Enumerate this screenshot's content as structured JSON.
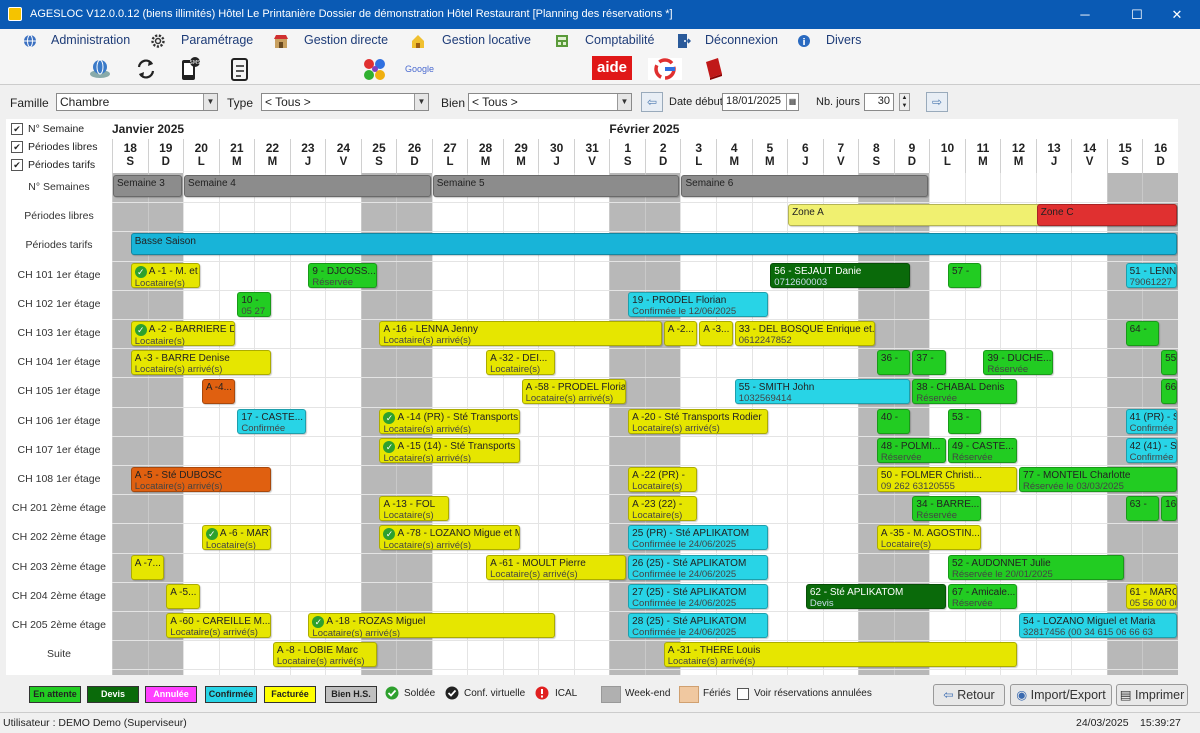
{
  "window": {
    "title": "AGESLOC V12.0.0.12 (biens illimités)   Hôtel Le Printanière   Dossier de démonstration Hôtel Restaurant   [Planning des réservations *]",
    "minimize": "─",
    "maximize": "☐",
    "close": "✕"
  },
  "menu": [
    {
      "label": "Administration",
      "icon": "globe-icon"
    },
    {
      "label": "Paramétrage",
      "icon": "gear-icon"
    },
    {
      "label": "Gestion directe",
      "icon": "shop-icon"
    },
    {
      "label": "Gestion locative",
      "icon": "house-icon"
    },
    {
      "label": "Comptabilité",
      "icon": "ledger-icon"
    },
    {
      "label": "Déconnexion",
      "icon": "door-icon"
    },
    {
      "label": "Divers",
      "icon": "info-icon"
    }
  ],
  "toolbar": {
    "google_label": "Google",
    "aide_label": "aide"
  },
  "filters": {
    "famille_label": "Famille",
    "famille_value": "Chambre",
    "type_label": "Type",
    "type_value": "< Tous >",
    "bien_label": "Bien",
    "bien_value": "< Tous >",
    "date_label": "Date début",
    "date_value": "18/01/2025",
    "nb_label": "Nb. jours",
    "nb_value": "30"
  },
  "checks": [
    {
      "label": "N° Semaine",
      "checked": true
    },
    {
      "label": "Périodes libres",
      "checked": true
    },
    {
      "label": "Périodes tarifs",
      "checked": true
    }
  ],
  "months": [
    {
      "label": "Janvier 2025",
      "day": 0
    },
    {
      "label": "Février 2025",
      "day": 14
    }
  ],
  "days": [
    {
      "n": "18",
      "l": "S",
      "we": true
    },
    {
      "n": "19",
      "l": "D",
      "we": true
    },
    {
      "n": "20",
      "l": "L"
    },
    {
      "n": "21",
      "l": "M"
    },
    {
      "n": "22",
      "l": "M"
    },
    {
      "n": "23",
      "l": "J"
    },
    {
      "n": "24",
      "l": "V"
    },
    {
      "n": "25",
      "l": "S",
      "we": true
    },
    {
      "n": "26",
      "l": "D",
      "we": true
    },
    {
      "n": "27",
      "l": "L"
    },
    {
      "n": "28",
      "l": "M"
    },
    {
      "n": "29",
      "l": "M"
    },
    {
      "n": "30",
      "l": "J"
    },
    {
      "n": "31",
      "l": "V"
    },
    {
      "n": "1",
      "l": "S",
      "we": true
    },
    {
      "n": "2",
      "l": "D",
      "we": true
    },
    {
      "n": "3",
      "l": "L"
    },
    {
      "n": "4",
      "l": "M"
    },
    {
      "n": "5",
      "l": "M"
    },
    {
      "n": "6",
      "l": "J"
    },
    {
      "n": "7",
      "l": "V"
    },
    {
      "n": "8",
      "l": "S",
      "we": true
    },
    {
      "n": "9",
      "l": "D",
      "we": true
    },
    {
      "n": "10",
      "l": "L"
    },
    {
      "n": "11",
      "l": "M"
    },
    {
      "n": "12",
      "l": "M"
    },
    {
      "n": "13",
      "l": "J"
    },
    {
      "n": "14",
      "l": "V"
    },
    {
      "n": "15",
      "l": "S",
      "we": true
    },
    {
      "n": "16",
      "l": "D",
      "we": true
    }
  ],
  "rows": [
    "N° Semaines",
    "Périodes libres",
    "Périodes tarifs",
    "CH 101 1er étage",
    "CH 102 1er étage",
    "CH 103 1er étage",
    "CH 104 1er étage",
    "CH 105 1er étage",
    "CH 106 1er étage",
    "CH 107 1er étage",
    "CH 108 1er étage",
    "CH 201 2ème étage",
    "CH 202 2ème étage",
    "CH 203 2ème étage",
    "CH 204 2ème étage",
    "CH 205 2ème étage",
    "Suite"
  ],
  "colors": {
    "grey": "#8c8c8c",
    "yellow": "#e6e600",
    "cyan": "#28d4e6",
    "green": "#22cc22",
    "dgreen": "#0a6a0a",
    "orange": "#e06010",
    "ltyellow": "#f0f070",
    "red": "#e03030",
    "blue": "#18b4d8"
  },
  "bars": [
    {
      "row": 0,
      "start": 0,
      "len": 2,
      "color": "grey",
      "t1": "Semaine 3",
      "t2": ""
    },
    {
      "row": 0,
      "start": 2,
      "len": 7,
      "color": "grey",
      "t1": "Semaine 4",
      "t2": ""
    },
    {
      "row": 0,
      "start": 9,
      "len": 7,
      "color": "grey",
      "t1": "Semaine 5",
      "t2": ""
    },
    {
      "row": 0,
      "start": 16,
      "len": 7,
      "color": "grey",
      "t1": "Semaine 6",
      "t2": ""
    },
    {
      "row": 1,
      "start": 19,
      "len": 11,
      "color": "ltyellow",
      "t1": "Zone A",
      "t2": ""
    },
    {
      "row": 1,
      "start": 26,
      "len": 4,
      "color": "red",
      "t1": "Zone C",
      "t2": ""
    },
    {
      "row": 2,
      "start": 0.5,
      "len": 29.5,
      "color": "blue",
      "t1": "Basse Saison",
      "t2": ""
    },
    {
      "row": 3,
      "start": 0.5,
      "len": 2,
      "color": "yellow",
      "t1": "A -1 - M. et",
      "t2": "Locataire(s)",
      "ok": true
    },
    {
      "row": 3,
      "start": 5.5,
      "len": 2,
      "color": "green",
      "t1": "9 - DJCOSS...",
      "t2": "Réservée"
    },
    {
      "row": 3,
      "start": 18.5,
      "len": 4,
      "color": "dgreen",
      "t1": "56 - SEJAUT Danie",
      "t2": "0712600003"
    },
    {
      "row": 3,
      "start": 23.5,
      "len": 1,
      "color": "green",
      "t1": "57 -",
      "t2": ""
    },
    {
      "row": 3,
      "start": 28.5,
      "len": 1.5,
      "color": "cyan",
      "t1": "51 - LENNA",
      "t2": "79061227"
    },
    {
      "row": 4,
      "start": 3.5,
      "len": 1,
      "color": "green",
      "t1": "10 -",
      "t2": "05 27"
    },
    {
      "row": 4,
      "start": 14.5,
      "len": 4,
      "color": "cyan",
      "t1": "19 - PRODEL Florian",
      "t2": "Confirmée le 12/06/2025"
    },
    {
      "row": 5,
      "start": 0.5,
      "len": 3,
      "color": "yellow",
      "t1": "A -2 - BARRIERE De",
      "t2": "Locataire(s)",
      "ok": true
    },
    {
      "row": 5,
      "start": 7.5,
      "len": 8,
      "color": "yellow",
      "t1": "A -16 - LENNA Jenny",
      "t2": "Locataire(s) arrivé(s)"
    },
    {
      "row": 5,
      "start": 15.5,
      "len": 1,
      "color": "yellow",
      "t1": "A -2...",
      "t2": ""
    },
    {
      "row": 5,
      "start": 16.5,
      "len": 1,
      "color": "yellow",
      "t1": "A -3...",
      "t2": ""
    },
    {
      "row": 5,
      "start": 17.5,
      "len": 4,
      "color": "yellow",
      "t1": "33 - DEL BOSQUE Enrique et...",
      "t2": "0612247852"
    },
    {
      "row": 5,
      "start": 28.5,
      "len": 1,
      "color": "green",
      "t1": "64 -",
      "t2": ""
    },
    {
      "row": 6,
      "start": 0.5,
      "len": 4,
      "color": "yellow",
      "t1": "A -3 - BARRE Denise",
      "t2": "Locataire(s) arrivé(s)"
    },
    {
      "row": 6,
      "start": 10.5,
      "len": 2,
      "color": "yellow",
      "t1": "A -32 - DEI...",
      "t2": "Locataire(s)"
    },
    {
      "row": 6,
      "start": 21.5,
      "len": 1,
      "color": "green",
      "t1": "36 -",
      "t2": ""
    },
    {
      "row": 6,
      "start": 22.5,
      "len": 1,
      "color": "green",
      "t1": "37 -",
      "t2": ""
    },
    {
      "row": 6,
      "start": 24.5,
      "len": 2,
      "color": "green",
      "t1": "39 - DUCHE...",
      "t2": "Réservée"
    },
    {
      "row": 6,
      "start": 29.5,
      "len": 0.5,
      "color": "green",
      "t1": "55",
      "t2": ""
    },
    {
      "row": 7,
      "start": 2.5,
      "len": 1,
      "color": "orange",
      "t1": "A -4...",
      "t2": ""
    },
    {
      "row": 7,
      "start": 11.5,
      "len": 3,
      "color": "yellow",
      "t1": "A -58 - PRODEL Florian",
      "t2": "Locataire(s) arrivé(s)"
    },
    {
      "row": 7,
      "start": 17.5,
      "len": 5,
      "color": "cyan",
      "t1": "55 - SMITH John",
      "t2": "1032569414"
    },
    {
      "row": 7,
      "start": 22.5,
      "len": 3,
      "color": "green",
      "t1": "38 - CHABAL Denis",
      "t2": "Réservée"
    },
    {
      "row": 7,
      "start": 29.5,
      "len": 0.5,
      "color": "green",
      "t1": "66",
      "t2": ""
    },
    {
      "row": 8,
      "start": 3.5,
      "len": 2,
      "color": "cyan",
      "t1": "17 - CASTE...",
      "t2": "Confirmée"
    },
    {
      "row": 8,
      "start": 7.5,
      "len": 4,
      "color": "yellow",
      "t1": "A -14 (PR) - Sté Transports",
      "t2": "Locataire(s) arrivé(s)",
      "ok": true
    },
    {
      "row": 8,
      "start": 14.5,
      "len": 4,
      "color": "yellow",
      "t1": "A -20 - Sté Transports Rodier",
      "t2": "Locataire(s) arrivé(s)"
    },
    {
      "row": 8,
      "start": 21.5,
      "len": 1,
      "color": "green",
      "t1": "40 -",
      "t2": ""
    },
    {
      "row": 8,
      "start": 23.5,
      "len": 1,
      "color": "green",
      "t1": "53 -",
      "t2": ""
    },
    {
      "row": 8,
      "start": 28.5,
      "len": 1.5,
      "color": "cyan",
      "t1": "41 (PR) - Sté",
      "t2": "Confirmée"
    },
    {
      "row": 9,
      "start": 7.5,
      "len": 4,
      "color": "yellow",
      "t1": "A -15 (14) - Sté Transports",
      "t2": "Locataire(s) arrivé(s)",
      "ok": true
    },
    {
      "row": 9,
      "start": 21.5,
      "len": 2,
      "color": "green",
      "t1": "48 - POLMI...",
      "t2": "Réservée"
    },
    {
      "row": 9,
      "start": 23.5,
      "len": 2,
      "color": "green",
      "t1": "49 - CASTE...",
      "t2": "Réservée"
    },
    {
      "row": 9,
      "start": 28.5,
      "len": 1.5,
      "color": "cyan",
      "t1": "42 (41) - Sté",
      "t2": "Confirmée"
    },
    {
      "row": 10,
      "start": 0.5,
      "len": 4,
      "color": "orange",
      "t1": "A -5 - Sté DUBOSC",
      "t2": "Locataire(s) arrivé(s)"
    },
    {
      "row": 10,
      "start": 14.5,
      "len": 2,
      "color": "yellow",
      "t1": "A -22 (PR) -",
      "t2": "Locataire(s)"
    },
    {
      "row": 10,
      "start": 21.5,
      "len": 4,
      "color": "yellow",
      "t1": "50 - FOLMER Christi...",
      "t2": "09 262 63120555"
    },
    {
      "row": 10,
      "start": 25.5,
      "len": 4.5,
      "color": "green",
      "t1": "77 - MONTEIL Charlotte",
      "t2": "Réservée le 03/03/2025"
    },
    {
      "row": 11,
      "start": 7.5,
      "len": 2,
      "color": "yellow",
      "t1": "A -13 - FOL",
      "t2": "Locataire(s)"
    },
    {
      "row": 11,
      "start": 14.5,
      "len": 2,
      "color": "yellow",
      "t1": "A -23 (22) -",
      "t2": "Locataire(s)"
    },
    {
      "row": 11,
      "start": 22.5,
      "len": 2,
      "color": "green",
      "t1": "34 - BARRE...",
      "t2": "Réservée"
    },
    {
      "row": 11,
      "start": 28.5,
      "len": 1,
      "color": "green",
      "t1": "63 -",
      "t2": ""
    },
    {
      "row": 11,
      "start": 29.5,
      "len": 0.5,
      "color": "green",
      "t1": "16",
      "t2": ""
    },
    {
      "row": 12,
      "start": 2.5,
      "len": 2,
      "color": "yellow",
      "t1": "A -6 - MART",
      "t2": "Locataire(s)",
      "ok": true
    },
    {
      "row": 12,
      "start": 7.5,
      "len": 4,
      "color": "yellow",
      "t1": "A -78 - LOZANO Migue et M",
      "t2": "Locataire(s) arrivé(s)",
      "ok": true
    },
    {
      "row": 12,
      "start": 14.5,
      "len": 4,
      "color": "cyan",
      "t1": "25 (PR) - Sté APLIKATOM",
      "t2": "Confirmée le 24/06/2025"
    },
    {
      "row": 12,
      "start": 21.5,
      "len": 3,
      "color": "yellow",
      "t1": "A -35 - M. AGOSTIN...",
      "t2": "Locataire(s)"
    },
    {
      "row": 13,
      "start": 0.5,
      "len": 1,
      "color": "yellow",
      "t1": "A -7...",
      "t2": ""
    },
    {
      "row": 13,
      "start": 10.5,
      "len": 4,
      "color": "yellow",
      "t1": "A -61 - MOULT Pierre",
      "t2": "Locataire(s) arrivé(s)"
    },
    {
      "row": 13,
      "start": 14.5,
      "len": 4,
      "color": "cyan",
      "t1": "26 (25) - Sté APLIKATOM",
      "t2": "Confirmée le 24/06/2025"
    },
    {
      "row": 13,
      "start": 23.5,
      "len": 5,
      "color": "green",
      "t1": "52 - AUDONNET Julie",
      "t2": "Réservée le 20/01/2025"
    },
    {
      "row": 14,
      "start": 1.5,
      "len": 1,
      "color": "yellow",
      "t1": "A -5...",
      "t2": ""
    },
    {
      "row": 14,
      "start": 14.5,
      "len": 4,
      "color": "cyan",
      "t1": "27 (25) - Sté APLIKATOM",
      "t2": "Confirmée le 24/06/2025"
    },
    {
      "row": 14,
      "start": 19.5,
      "len": 4,
      "color": "dgreen",
      "t1": "62 - Sté APLIKATOM",
      "t2": "Devis"
    },
    {
      "row": 14,
      "start": 23.5,
      "len": 2,
      "color": "green",
      "t1": "67 - Amicale...",
      "t2": "Réservée"
    },
    {
      "row": 14,
      "start": 28.5,
      "len": 1.5,
      "color": "yellow",
      "t1": "61 - MARCO",
      "t2": "05 56 00 00"
    },
    {
      "row": 15,
      "start": 1.5,
      "len": 3,
      "color": "yellow",
      "t1": "A -60 - CAREILLE M...",
      "t2": "Locataire(s) arrivé(s)"
    },
    {
      "row": 15,
      "start": 5.5,
      "len": 7,
      "color": "yellow",
      "t1": "A -18 - ROZAS Miguel",
      "t2": "Locataire(s) arrivé(s)",
      "ok": true
    },
    {
      "row": 15,
      "start": 14.5,
      "len": 4,
      "color": "cyan",
      "t1": "28 (25) - Sté APLIKATOM",
      "t2": "Confirmée le 24/06/2025"
    },
    {
      "row": 15,
      "start": 25.5,
      "len": 4.5,
      "color": "cyan",
      "t1": "54 - LOZANO Miguel et Maria",
      "t2": "32817456 (00 34 615 06 66 63"
    },
    {
      "row": 16,
      "start": 4.5,
      "len": 3,
      "color": "yellow",
      "t1": "A -8 - LOBIE Marc",
      "t2": "Locataire(s) arrivé(s)"
    },
    {
      "row": 16,
      "start": 15.5,
      "len": 10,
      "color": "yellow",
      "t1": "A -31 - THERE Louis",
      "t2": "Locataire(s) arrivé(s)"
    }
  ],
  "legend": [
    {
      "label": "En attente",
      "bg": "#22cc22"
    },
    {
      "label": "Devis",
      "bg": "#0a6a0a"
    },
    {
      "label": "Annulée",
      "bg": "#ff40ff"
    },
    {
      "label": "Confirmée",
      "bg": "#28d4e6"
    },
    {
      "label": "Facturée",
      "bg": "#ffff00"
    },
    {
      "label": "Bien H.S.",
      "bg": "#c0c0c0"
    }
  ],
  "legend_icons": {
    "soldee": "Soldée",
    "conf": "Conf. virtuelle",
    "ical": "ICAL",
    "weekend": "Week-end",
    "feries": "Fériés",
    "annulees": "Voir réservations annulées"
  },
  "buttons": {
    "retour": "Retour",
    "export": "Import/Export",
    "imprimer": "Imprimer"
  },
  "status": {
    "user": "Utilisateur : DEMO Demo (Superviseur)",
    "date": "24/03/2025",
    "time": "15:39:27"
  }
}
